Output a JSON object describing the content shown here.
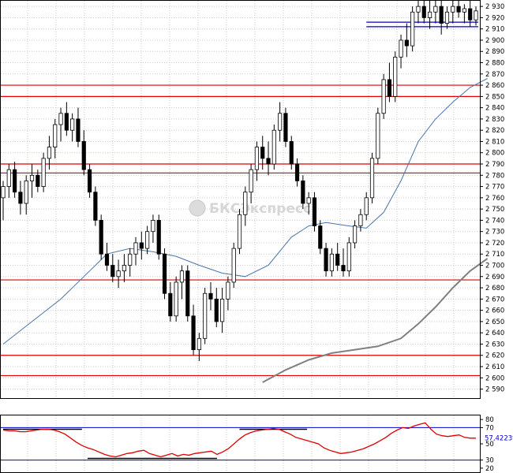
{
  "watermark": "БКСЭкспресс",
  "colors": {
    "background": "#ffffff",
    "grid": "#c8c8c8",
    "level_line": "#e00000",
    "channel_line": "#0000cc",
    "candle_up_fill": "#ffffff",
    "candle_down_fill": "#000000",
    "candle_stroke": "#000000",
    "ma_fast": "#4a74a8",
    "ma_slow": "#808080",
    "oscillator": "#e00000",
    "osc_level": "#0000cc",
    "osc_trend": "#000000"
  },
  "chart_data": [
    {
      "type": "candlestick",
      "ylim": [
        2582,
        2935
      ],
      "yticks": [
        "2 590",
        "2 600",
        "2 610",
        "2 620",
        "2 630",
        "2 640",
        "2 650",
        "2 660",
        "2 670",
        "2 680",
        "2 690",
        "2 700",
        "2 710",
        "2 720",
        "2 730",
        "2 740",
        "2 750",
        "2 760",
        "2 770",
        "2 780",
        "2 790",
        "2 800",
        "2 810",
        "2 820",
        "2 830",
        "2 840",
        "2 850",
        "2 860",
        "2 870",
        "2 880",
        "2 890",
        "2 900",
        "2 910",
        "2 920",
        "2 930"
      ],
      "horizontal_levels": [
        2860,
        2850,
        2790,
        2782,
        2687,
        2620,
        2602
      ],
      "channel_levels": [
        2916,
        2912
      ],
      "candles": [
        [
          2760,
          2775,
          2740,
          2770
        ],
        [
          2770,
          2790,
          2760,
          2785
        ],
        [
          2785,
          2792,
          2760,
          2765
        ],
        [
          2765,
          2775,
          2745,
          2755
        ],
        [
          2755,
          2780,
          2745,
          2775
        ],
        [
          2775,
          2790,
          2760,
          2780
        ],
        [
          2780,
          2785,
          2765,
          2770
        ],
        [
          2770,
          2800,
          2765,
          2795
        ],
        [
          2795,
          2815,
          2785,
          2805
        ],
        [
          2805,
          2830,
          2795,
          2825
        ],
        [
          2825,
          2840,
          2810,
          2835
        ],
        [
          2835,
          2845,
          2815,
          2820
        ],
        [
          2820,
          2835,
          2810,
          2830
        ],
        [
          2830,
          2840,
          2805,
          2810
        ],
        [
          2810,
          2820,
          2780,
          2785
        ],
        [
          2785,
          2790,
          2760,
          2765
        ],
        [
          2765,
          2770,
          2735,
          2740
        ],
        [
          2740,
          2745,
          2705,
          2710
        ],
        [
          2710,
          2720,
          2695,
          2700
        ],
        [
          2700,
          2710,
          2685,
          2690
        ],
        [
          2690,
          2705,
          2680,
          2695
        ],
        [
          2695,
          2710,
          2685,
          2700
        ],
        [
          2700,
          2715,
          2690,
          2710
        ],
        [
          2710,
          2725,
          2700,
          2720
        ],
        [
          2720,
          2730,
          2705,
          2715
        ],
        [
          2715,
          2735,
          2710,
          2730
        ],
        [
          2730,
          2745,
          2720,
          2740
        ],
        [
          2740,
          2745,
          2705,
          2710
        ],
        [
          2710,
          2715,
          2670,
          2675
        ],
        [
          2675,
          2685,
          2650,
          2655
        ],
        [
          2655,
          2690,
          2650,
          2685
        ],
        [
          2685,
          2700,
          2670,
          2695
        ],
        [
          2695,
          2700,
          2650,
          2655
        ],
        [
          2655,
          2665,
          2620,
          2625
        ],
        [
          2625,
          2640,
          2615,
          2635
        ],
        [
          2635,
          2680,
          2630,
          2675
        ],
        [
          2675,
          2685,
          2660,
          2670
        ],
        [
          2670,
          2680,
          2645,
          2650
        ],
        [
          2650,
          2680,
          2640,
          2670
        ],
        [
          2670,
          2690,
          2660,
          2685
        ],
        [
          2685,
          2720,
          2680,
          2715
        ],
        [
          2715,
          2750,
          2710,
          2745
        ],
        [
          2745,
          2770,
          2735,
          2765
        ],
        [
          2765,
          2790,
          2755,
          2785
        ],
        [
          2785,
          2810,
          2775,
          2805
        ],
        [
          2805,
          2815,
          2785,
          2795
        ],
        [
          2795,
          2810,
          2780,
          2790
        ],
        [
          2790,
          2825,
          2785,
          2820
        ],
        [
          2820,
          2845,
          2810,
          2835
        ],
        [
          2835,
          2840,
          2805,
          2810
        ],
        [
          2810,
          2815,
          2785,
          2790
        ],
        [
          2790,
          2795,
          2770,
          2775
        ],
        [
          2775,
          2780,
          2750,
          2755
        ],
        [
          2755,
          2765,
          2745,
          2760
        ],
        [
          2760,
          2765,
          2730,
          2735
        ],
        [
          2735,
          2740,
          2710,
          2715
        ],
        [
          2715,
          2720,
          2690,
          2695
        ],
        [
          2695,
          2715,
          2690,
          2710
        ],
        [
          2710,
          2720,
          2695,
          2700
        ],
        [
          2700,
          2715,
          2690,
          2695
        ],
        [
          2695,
          2725,
          2690,
          2720
        ],
        [
          2720,
          2740,
          2715,
          2735
        ],
        [
          2735,
          2750,
          2730,
          2745
        ],
        [
          2745,
          2765,
          2740,
          2760
        ],
        [
          2760,
          2800,
          2755,
          2795
        ],
        [
          2795,
          2840,
          2790,
          2835
        ],
        [
          2835,
          2870,
          2830,
          2865
        ],
        [
          2865,
          2880,
          2845,
          2850
        ],
        [
          2850,
          2890,
          2845,
          2885
        ],
        [
          2885,
          2905,
          2875,
          2900
        ],
        [
          2900,
          2915,
          2885,
          2895
        ],
        [
          2895,
          2930,
          2890,
          2925
        ],
        [
          2925,
          2935,
          2915,
          2930
        ],
        [
          2930,
          2935,
          2915,
          2920
        ],
        [
          2920,
          2935,
          2910,
          2925
        ],
        [
          2925,
          2935,
          2915,
          2930
        ],
        [
          2930,
          2935,
          2905,
          2915
        ],
        [
          2915,
          2930,
          2910,
          2925
        ],
        [
          2925,
          2935,
          2915,
          2930
        ],
        [
          2930,
          2935,
          2920,
          2925
        ],
        [
          2925,
          2932,
          2915,
          2928
        ],
        [
          2928,
          2935,
          2912,
          2918
        ],
        [
          2918,
          2930,
          2913,
          2926
        ]
      ],
      "moving_averages": [
        {
          "name": "",
          "points": [
            [
              0,
              2630
            ],
            [
              5,
              2650
            ],
            [
              10,
              2670
            ],
            [
              14,
              2690
            ],
            [
              18,
              2710
            ],
            [
              22,
              2715
            ],
            [
              26,
              2712
            ],
            [
              30,
              2708
            ],
            [
              34,
              2700
            ],
            [
              38,
              2693
            ],
            [
              42,
              2690
            ],
            [
              46,
              2700
            ],
            [
              50,
              2725
            ],
            [
              53,
              2735
            ],
            [
              56,
              2738
            ],
            [
              60,
              2735
            ],
            [
              63,
              2733
            ],
            [
              66,
              2747
            ],
            [
              69,
              2775
            ],
            [
              72,
              2810
            ],
            [
              75,
              2830
            ],
            [
              78,
              2845
            ],
            [
              81,
              2858
            ],
            [
              84,
              2866
            ]
          ]
        },
        {
          "name": "",
          "points": [
            [
              45,
              2596
            ],
            [
              49,
              2607
            ],
            [
              53,
              2616
            ],
            [
              57,
              2622
            ],
            [
              61,
              2625
            ],
            [
              65,
              2628
            ],
            [
              69,
              2635
            ],
            [
              72,
              2648
            ],
            [
              75,
              2663
            ],
            [
              78,
              2680
            ],
            [
              81,
              2695
            ],
            [
              84,
              2706
            ]
          ]
        }
      ]
    },
    {
      "type": "line",
      "ylim": [
        15,
        85
      ],
      "yticks": [
        "80",
        "70",
        "50",
        "30",
        "20"
      ],
      "levels": [
        70,
        30
      ],
      "current_value": "57,42239",
      "values": [
        67,
        66,
        66,
        65,
        65,
        66,
        67,
        68,
        68,
        67,
        65,
        62,
        57,
        52,
        48,
        45,
        43,
        40,
        37,
        35,
        34,
        36,
        38,
        39,
        41,
        42,
        38,
        36,
        34,
        36,
        38,
        35,
        37,
        36,
        38,
        39,
        40,
        41,
        37,
        40,
        44,
        50,
        56,
        61,
        64,
        66,
        67,
        68,
        69,
        68,
        65,
        62,
        58,
        56,
        54,
        52,
        50,
        45,
        42,
        40,
        38,
        39,
        40,
        42,
        44,
        47,
        50,
        54,
        58,
        63,
        67,
        70,
        69,
        72,
        74,
        76,
        68,
        62,
        60,
        59,
        60,
        61,
        58,
        57,
        57
      ],
      "trendlines": [
        {
          "from": [
            0,
            68
          ],
          "to": [
            14,
            68
          ]
        },
        {
          "from": [
            15,
            32
          ],
          "to": [
            38,
            32
          ]
        },
        {
          "from": [
            42,
            68
          ],
          "to": [
            54,
            68
          ]
        }
      ]
    }
  ]
}
